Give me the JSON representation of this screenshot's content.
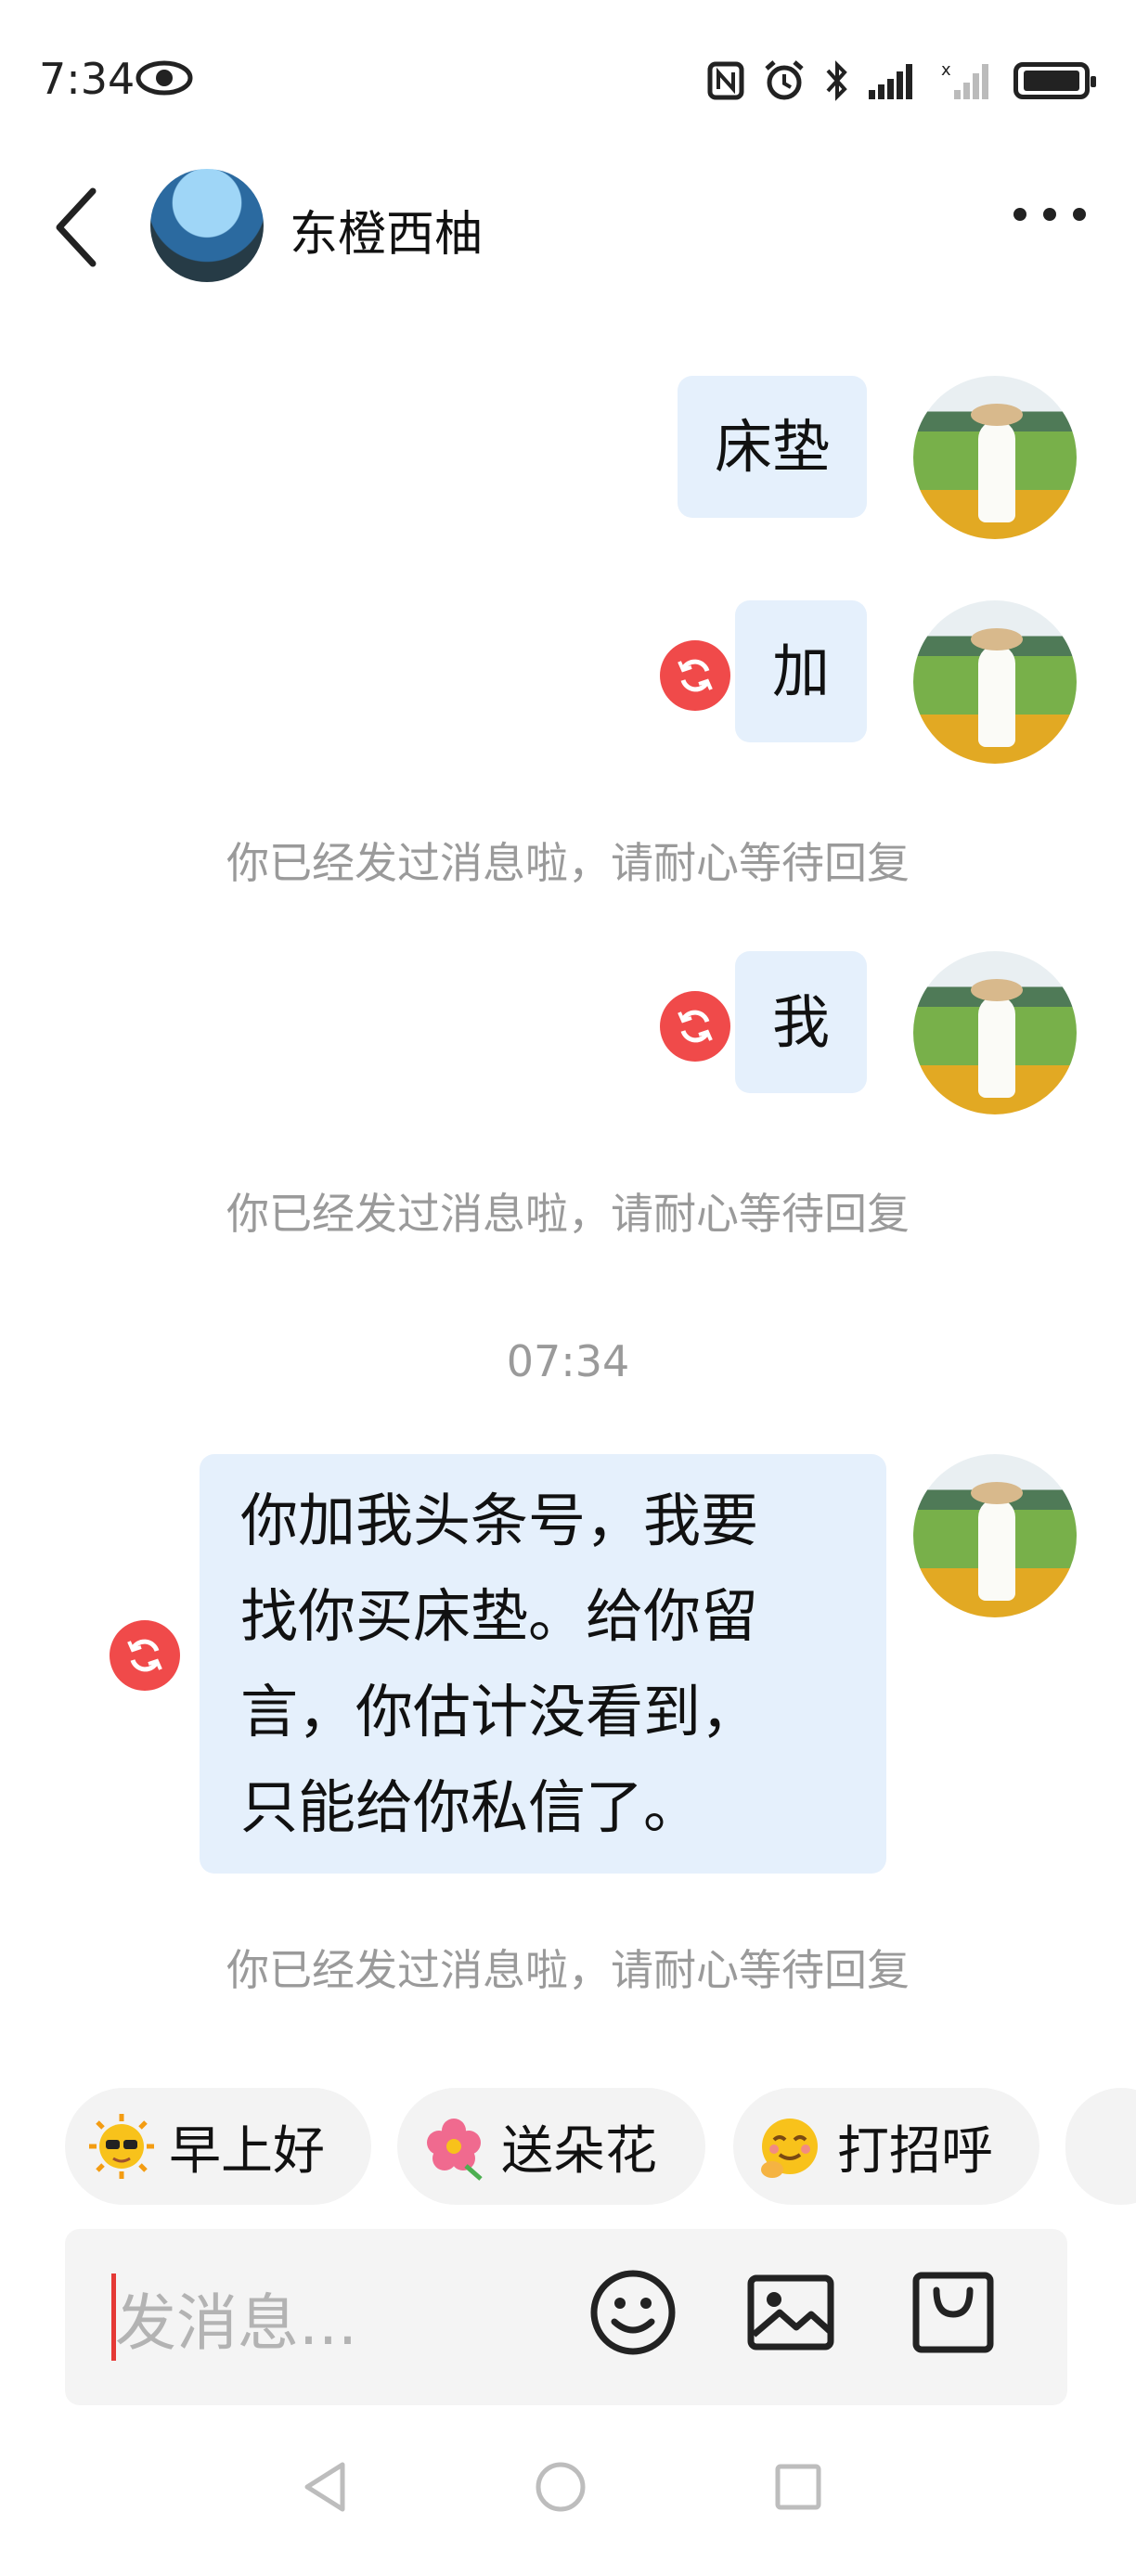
{
  "status_bar": {
    "time": "7:34"
  },
  "header": {
    "contact_name": "东橙西柚"
  },
  "messages": [
    {
      "text": "床垫",
      "failed": false
    },
    {
      "text": "加",
      "failed": true
    },
    {
      "text": "我",
      "failed": true
    },
    {
      "lines": [
        "你加我头条号，我要",
        "找你买床垫。给你留",
        "言，你估计没看到，",
        "只能给你私信了。"
      ],
      "failed": true
    }
  ],
  "notices": [
    "你已经发过消息啦，请耐心等待回复",
    "你已经发过消息啦，请耐心等待回复",
    "你已经发过消息啦，请耐心等待回复"
  ],
  "timestamp": "07:34",
  "quick_replies": [
    {
      "label": "早上好",
      "icon": "sun-sunglasses-emoji"
    },
    {
      "label": "送朵花",
      "icon": "flower-emoji"
    },
    {
      "label": "打招呼",
      "icon": "smiling-wave-emoji"
    }
  ],
  "input": {
    "placeholder": "发消息..."
  },
  "colors": {
    "bubble": "#e5f0fc",
    "failed": "#f04a4a",
    "notice": "#9a9a9a",
    "caret": "#e53935"
  }
}
